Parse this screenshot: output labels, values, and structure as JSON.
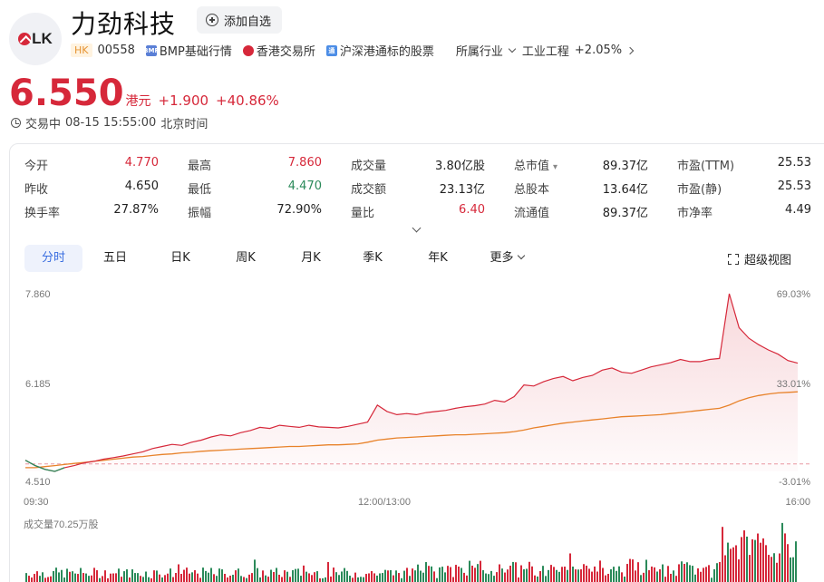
{
  "header": {
    "logo_text": "LK",
    "title": "力劲科技",
    "watch_label": "添加自选",
    "market_tag": "HK",
    "code": "00558",
    "feed_label": "BMP基础行情",
    "feed_icon_text": "BMP",
    "exchange_label": "香港交易所",
    "connect_label": "沪深港通标的股票",
    "connect_icon_text": "通",
    "industry_label": "所属行业",
    "industry_name": "工业工程",
    "industry_change": "+2.05%"
  },
  "quote": {
    "price": "6.550",
    "currency": "港元",
    "change": "+1.900",
    "change_pct": "+40.86%",
    "status": "交易中",
    "time": "08-15 15:55:00",
    "timezone": "北京时间"
  },
  "stats": [
    {
      "label": "今开",
      "value": "4.770",
      "tone": "up"
    },
    {
      "label": "最高",
      "value": "7.860",
      "tone": "up"
    },
    {
      "label": "成交量",
      "value": "3.80亿股",
      "tone": "neutral"
    },
    {
      "label": "总市值",
      "value": "89.37亿",
      "tone": "neutral",
      "caret": "▾"
    },
    {
      "label": "市盈(TTM)",
      "value": "25.53",
      "tone": "neutral"
    },
    {
      "label": "昨收",
      "value": "4.650",
      "tone": "neutral"
    },
    {
      "label": "最低",
      "value": "4.470",
      "tone": "down"
    },
    {
      "label": "成交额",
      "value": "23.13亿",
      "tone": "neutral"
    },
    {
      "label": "总股本",
      "value": "13.64亿",
      "tone": "neutral"
    },
    {
      "label": "市盈(静)",
      "value": "25.53",
      "tone": "neutral"
    },
    {
      "label": "换手率",
      "value": "27.87%",
      "tone": "neutral"
    },
    {
      "label": "振幅",
      "value": "72.90%",
      "tone": "neutral"
    },
    {
      "label": "量比",
      "value": "6.40",
      "tone": "up"
    },
    {
      "label": "流通值",
      "value": "89.37亿",
      "tone": "neutral"
    },
    {
      "label": "市净率",
      "value": "4.49",
      "tone": "neutral"
    }
  ],
  "tabs": [
    "分时",
    "五日",
    "日K",
    "周K",
    "月K",
    "季K",
    "年K",
    "更多"
  ],
  "active_tab": 0,
  "fullview_label": "超级视图",
  "colors": {
    "up": "#d6283a",
    "down": "#2b8a5a",
    "accent": "#3a6ee0",
    "avg_line": "#e8822a"
  },
  "chart_data": {
    "type": "line",
    "y_left_labels": [
      "7.860",
      "6.185",
      "4.510"
    ],
    "y_right_labels": [
      "69.03%",
      "33.01%",
      "-3.01%"
    ],
    "x_labels": [
      "09:30",
      "12:00/13:00",
      "16:00"
    ],
    "prev_close": 4.65,
    "ylim": [
      4.51,
      7.86
    ],
    "volume_label": "成交量70.25万股",
    "series": [
      {
        "name": "price",
        "color": "#d6283a",
        "values": [
          4.72,
          4.62,
          4.55,
          4.51,
          4.58,
          4.62,
          4.67,
          4.7,
          4.74,
          4.77,
          4.8,
          4.84,
          4.88,
          4.94,
          4.98,
          5.02,
          5.0,
          5.06,
          5.1,
          5.16,
          5.2,
          5.18,
          5.24,
          5.28,
          5.34,
          5.32,
          5.38,
          5.36,
          5.34,
          5.38,
          5.35,
          5.34,
          5.33,
          5.36,
          5.4,
          5.44,
          5.76,
          5.64,
          5.58,
          5.6,
          5.58,
          5.62,
          5.64,
          5.66,
          5.7,
          5.73,
          5.75,
          5.78,
          5.85,
          5.82,
          5.92,
          6.14,
          6.12,
          6.2,
          6.26,
          6.3,
          6.22,
          6.28,
          6.32,
          6.42,
          6.46,
          6.38,
          6.36,
          6.42,
          6.48,
          6.52,
          6.56,
          6.62,
          6.58,
          6.58,
          6.62,
          6.64,
          7.86,
          7.22,
          7.02,
          6.9,
          6.8,
          6.72,
          6.6,
          6.55
        ]
      },
      {
        "name": "avg",
        "color": "#e8822a",
        "values": [
          4.58,
          4.58,
          4.6,
          4.62,
          4.64,
          4.66,
          4.68,
          4.7,
          4.72,
          4.74,
          4.76,
          4.78,
          4.79,
          4.81,
          4.83,
          4.84,
          4.86,
          4.87,
          4.89,
          4.9,
          4.91,
          4.92,
          4.93,
          4.94,
          4.95,
          4.96,
          4.97,
          4.98,
          4.98,
          4.99,
          5.0,
          5.01,
          5.01,
          5.02,
          5.03,
          5.06,
          5.1,
          5.12,
          5.14,
          5.15,
          5.16,
          5.17,
          5.18,
          5.19,
          5.2,
          5.2,
          5.21,
          5.22,
          5.23,
          5.24,
          5.26,
          5.29,
          5.33,
          5.36,
          5.39,
          5.42,
          5.44,
          5.46,
          5.48,
          5.5,
          5.52,
          5.54,
          5.55,
          5.56,
          5.57,
          5.58,
          5.6,
          5.62,
          5.64,
          5.66,
          5.68,
          5.7,
          5.76,
          5.84,
          5.9,
          5.94,
          5.97,
          5.99,
          6.0,
          6.01
        ]
      }
    ]
  }
}
